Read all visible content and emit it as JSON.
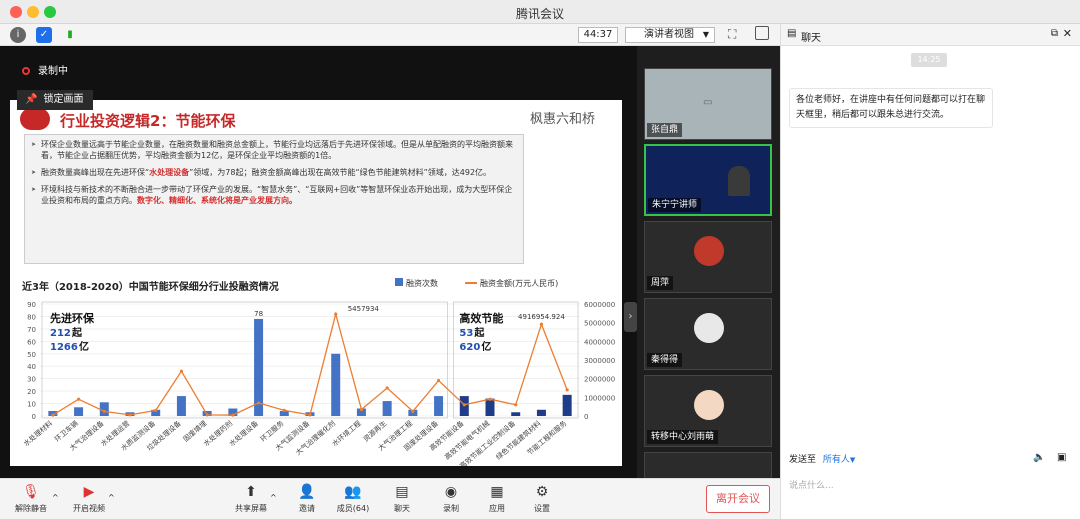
{
  "window": {
    "title": "腾讯会议"
  },
  "toolbar": {
    "timer": "44:37",
    "view_mode": "演讲者视图"
  },
  "stage": {
    "recording": "录制中",
    "lock_view": "锁定画面"
  },
  "slide": {
    "title": "行业投资逻辑2：节能环保",
    "brand": "枫惠六和桥",
    "bullets": [
      [
        "环保企业数量远高于节能企业数量，在融资数量和融资总金额上，节能行业均远落后于先进环保领域。但是从单配融资的平均融资额来看，节能企业占据翻压优势，平均融资金额为12亿，是环保企业平均融资额的1倍。",
        "",
        ""
      ],
      [
        "融资数量高峰出现在先进环保“",
        "水处理设备",
        "”领域，为78起；融资金额高峰出现在高效节能“绿色节能建筑材料”领域，达492亿。"
      ],
      [
        "环境科技与新技术的不断融合进一步带动了环保产业的发展。“智慧水务”、“互联网+回收”等智慧环保业态开始出现，成为大型环保企业投资和布局的重点方向。",
        "数字化、精细化、系统化将是产业发展方向。",
        ""
      ]
    ]
  },
  "chart_data": {
    "type": "bar",
    "title": "近3年（2018-2020）中国节能环保细分行业投融资情况",
    "legend": [
      "融资次数",
      "融资金额(万元人民币)"
    ],
    "categories": [
      "水处理材料",
      "环卫车辆",
      "大气治理设备",
      "水处理运营",
      "水质监测设备",
      "垃圾处理设备",
      "固废填埋",
      "水处理药剂",
      "水处理设备",
      "环卫服务",
      "大气监测设备",
      "大气治理催化剂",
      "水环境工程",
      "资源再生",
      "大气治理工程",
      "固废处理设备",
      "高效节能设备",
      "高效节能电气机械",
      "高效节能工业控制设备",
      "绿色节能建筑材料",
      "节能工程和服务"
    ],
    "series": [
      {
        "name": "融资次数",
        "values": [
          4,
          7,
          11,
          3,
          5,
          16,
          4,
          6,
          78,
          4,
          3,
          50,
          6,
          12,
          5,
          16,
          16,
          14,
          3,
          5,
          17
        ],
        "axis": "left"
      },
      {
        "name": "融资金额(万元人民币)",
        "values": [
          50000,
          900000,
          250000,
          60000,
          300000,
          2400000,
          60000,
          50000,
          700000,
          300000,
          60000,
          5457934,
          350000,
          1500000,
          250000,
          1900000,
          600000,
          900000,
          600000,
          4916954.924,
          1400000
        ],
        "axis": "right"
      }
    ],
    "ylim": [
      0,
      90
    ],
    "y2lim": [
      0,
      6000000
    ],
    "yticks": [
      0,
      10,
      20,
      30,
      40,
      50,
      60,
      70,
      80,
      90
    ],
    "y2ticks": [
      0,
      1000000,
      2000000,
      3000000,
      4000000,
      5000000,
      6000000
    ],
    "annotations": [
      "78",
      "5457934",
      "4916954.924"
    ],
    "groups": [
      {
        "title": "先进环保",
        "count": "212",
        "count_unit": "起",
        "amount": "1266",
        "amount_unit": "亿"
      },
      {
        "title": "高效节能",
        "count": "53",
        "count_unit": "起",
        "amount": "620",
        "amount_unit": "亿"
      }
    ],
    "colors": {
      "bar": "#4472c4",
      "line": "#ed7d31"
    }
  },
  "participants": [
    {
      "name": "张自鼎"
    },
    {
      "name": "朱宁宁讲师"
    },
    {
      "name": "周萍"
    },
    {
      "name": "秦得得"
    },
    {
      "name": "转移中心刘雨萌"
    }
  ],
  "chat": {
    "title": "聊天",
    "time": "14:25",
    "message": "各位老师好，在讲座中有任何问题都可以打在聊天框里，稍后都可以跟朱总进行交流。",
    "send_to_label": "发送至",
    "send_to_value": "所有人",
    "input_placeholder": "说点什么..."
  },
  "bottom": {
    "mute": "解除静音",
    "video": "开启视频",
    "share": "共享屏幕",
    "invite": "邀请",
    "members": "成员(64)",
    "chat": "聊天",
    "record": "录制",
    "apps": "应用",
    "settings": "设置",
    "leave": "离开会议"
  }
}
